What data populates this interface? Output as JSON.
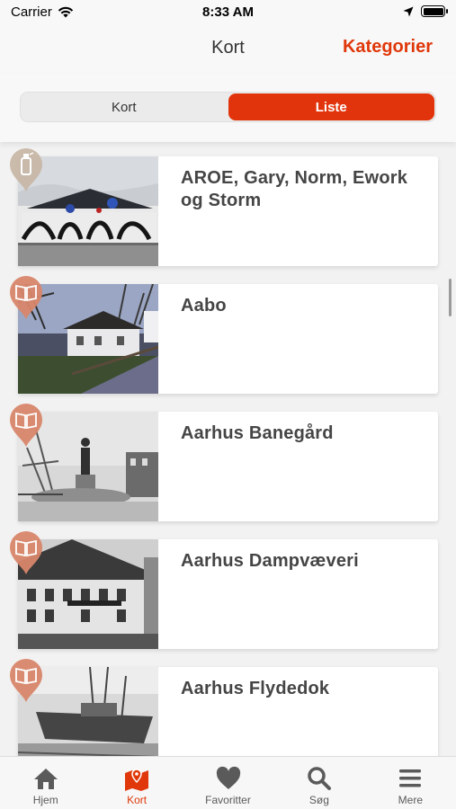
{
  "status_bar": {
    "carrier": "Carrier",
    "time": "8:33 AM"
  },
  "nav": {
    "title": "Kort",
    "action": "Kategorier"
  },
  "segments": {
    "left": "Kort",
    "right": "Liste",
    "selected": "Liste"
  },
  "items": [
    {
      "title": "AROE, Gary, Norm, Ework og Storm",
      "category_icon": "spray-can-icon",
      "pin_color": "#c9b8a8"
    },
    {
      "title": "Aabo",
      "category_icon": "book-icon",
      "pin_color": "#d98a6c"
    },
    {
      "title": "Aarhus Banegård",
      "category_icon": "book-icon",
      "pin_color": "#d98a6c"
    },
    {
      "title": "Aarhus Dampvæveri",
      "category_icon": "book-icon",
      "pin_color": "#d98a6c"
    },
    {
      "title": "Aarhus Flydedok",
      "category_icon": "book-icon",
      "pin_color": "#d98a6c"
    }
  ],
  "tabs": [
    {
      "label": "Hjem",
      "icon": "home-icon",
      "active": false
    },
    {
      "label": "Kort",
      "icon": "map-icon",
      "active": true
    },
    {
      "label": "Favoritter",
      "icon": "heart-icon",
      "active": false
    },
    {
      "label": "Søg",
      "icon": "search-icon",
      "active": false
    },
    {
      "label": "Mere",
      "icon": "menu-icon",
      "active": false
    }
  ],
  "colors": {
    "accent": "#e2340c",
    "tab_inactive": "#5a5a5a"
  }
}
